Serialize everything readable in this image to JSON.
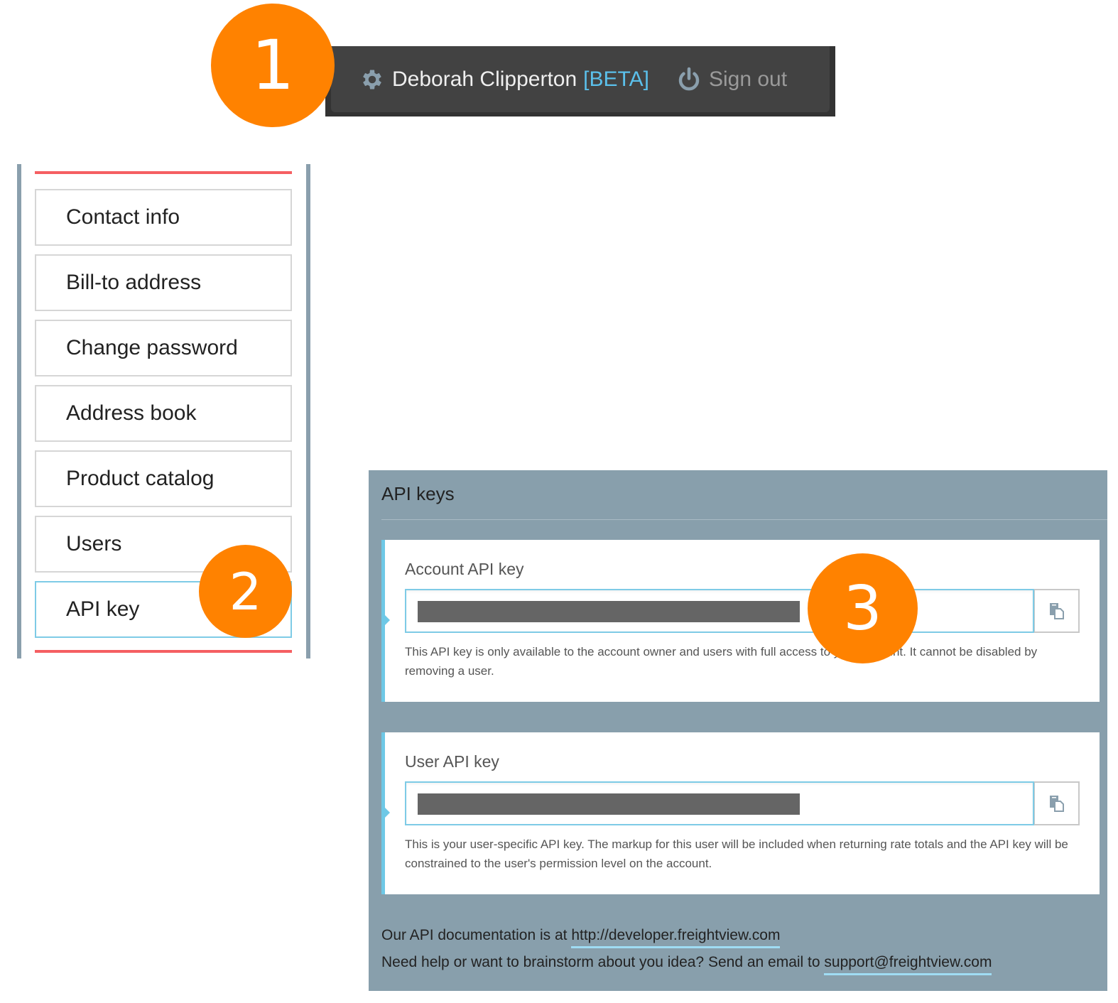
{
  "callouts": [
    "1",
    "2",
    "3"
  ],
  "header": {
    "user_name": "Deborah Clipperton",
    "beta_label": "[BETA]",
    "signout_label": "Sign out",
    "icons": {
      "settings": "gear-icon",
      "signout": "power-icon"
    }
  },
  "sidebar": {
    "items": [
      {
        "label": "Contact info",
        "active": false
      },
      {
        "label": "Bill-to address",
        "active": false
      },
      {
        "label": "Change password",
        "active": false
      },
      {
        "label": "Address book",
        "active": false
      },
      {
        "label": "Product catalog",
        "active": false
      },
      {
        "label": "Users",
        "active": false
      },
      {
        "label": "API key",
        "active": true
      }
    ]
  },
  "api_panel": {
    "title": "API keys",
    "account_key": {
      "label": "Account API key",
      "value": "[redacted]",
      "copy_icon": "copy-icon",
      "help": "This API key is only available to the account owner and users with full access to your account. It cannot be disabled by removing a user."
    },
    "user_key": {
      "label": "User API key",
      "value": "[redacted]",
      "copy_icon": "copy-icon",
      "help": "This is your user-specific API key. The markup for this user will be included when returning rate totals and the API key will be constrained to the user's permission level on the account."
    },
    "footer": {
      "docs_prefix": "Our API documentation is at ",
      "docs_link": "http://developer.freightview.com",
      "help_prefix": "Need help or want to brainstorm about you idea? Send an email to ",
      "help_link": "support@freightview.com"
    }
  },
  "colors": {
    "accent_orange": "#ff8200",
    "accent_blue": "#5bc0eb",
    "panel_bg": "#889fac",
    "header_bg": "#424242",
    "sidebar_red": "#f55f62"
  }
}
